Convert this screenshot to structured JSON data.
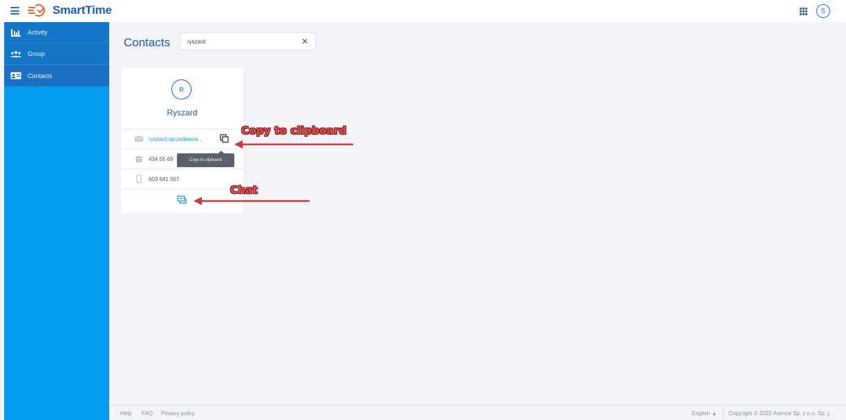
{
  "app": {
    "title": "SmartTime",
    "user_initial": "S"
  },
  "sidebar": {
    "items": [
      {
        "label": "Activity",
        "icon": "bar-chart-icon"
      },
      {
        "label": "Group",
        "icon": "group-icon"
      },
      {
        "label": "Contacts",
        "icon": "contact-card-icon",
        "active": true
      }
    ]
  },
  "main": {
    "title": "Contacts",
    "search": {
      "value": "ryszard",
      "placeholder": ""
    }
  },
  "contact": {
    "initial": "R",
    "name": "Ryszard",
    "email": "ryszard.sprzedawca...",
    "phone": "434 55 69",
    "mobile": "603 641 567"
  },
  "tooltip": {
    "text": "Copy to clipboard"
  },
  "annotations": {
    "copy": "Copy to clipboard",
    "chat": "Chat",
    "color": "#e64b50"
  },
  "footer": {
    "help": "Help",
    "faq": "FAQ",
    "privacy": "Privacy policy",
    "language": "English",
    "copyright": "Copyright © 2022 Axence Sp. z o.o. Sp. j."
  },
  "colors": {
    "sidebar": "#049cf1",
    "sidebar_active": "#1a71c3",
    "brand": "#1a5fb4",
    "accent": "#1a9be8"
  }
}
